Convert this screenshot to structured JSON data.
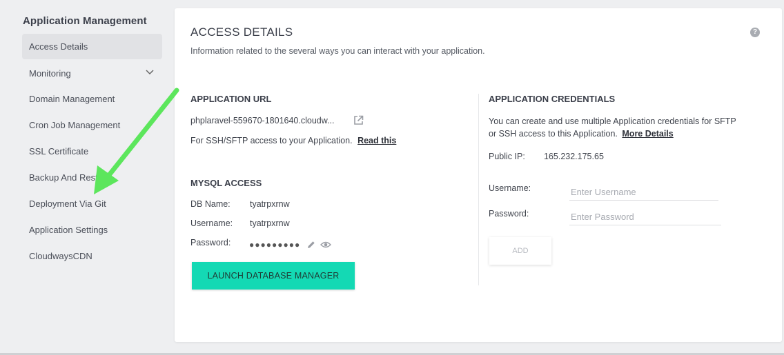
{
  "sidebar": {
    "title": "Application Management",
    "items": [
      {
        "label": "Access Details"
      },
      {
        "label": "Monitoring"
      },
      {
        "label": "Domain Management"
      },
      {
        "label": "Cron Job Management"
      },
      {
        "label": "SSL Certificate"
      },
      {
        "label": "Backup And Restore"
      },
      {
        "label": "Deployment Via Git"
      },
      {
        "label": "Application Settings"
      },
      {
        "label": "CloudwaysCDN"
      }
    ]
  },
  "main": {
    "title": "ACCESS DETAILS",
    "description": "Information related to the several ways you can interact with your application.",
    "help_icon_glyph": "?",
    "app_url": {
      "heading": "APPLICATION URL",
      "url": "phplaravel-559670-1801640.cloudw...",
      "note": "For SSH/SFTP access to your Application.",
      "read_link": "Read this"
    },
    "mysql": {
      "heading": "MYSQL ACCESS",
      "db_name_label": "DB Name:",
      "db_name": "tyatrpxrnw",
      "username_label": "Username:",
      "username": "tyatrpxrnw",
      "password_label": "Password:",
      "password_masked": "●●●●●●●●●",
      "launch_button": "LAUNCH DATABASE MANAGER"
    },
    "credentials": {
      "heading": "APPLICATION CREDENTIALS",
      "desc_line1": "You can create and use multiple Application credentials for SFTP",
      "desc_line2": "or SSH access to this Application.",
      "more_link": "More Details",
      "public_ip_label": "Public IP:",
      "public_ip": "165.232.175.65",
      "username_label": "Username:",
      "username_placeholder": "Enter Username",
      "password_label": "Password:",
      "password_placeholder": "Enter Password",
      "add_button": "ADD"
    }
  },
  "colors": {
    "accent": "#14d9b4",
    "annotation_arrow": "#5ce65c"
  },
  "icons": [
    "chevron-down-icon",
    "help-icon",
    "external-link-icon",
    "edit-pencil-icon",
    "eye-icon"
  ]
}
